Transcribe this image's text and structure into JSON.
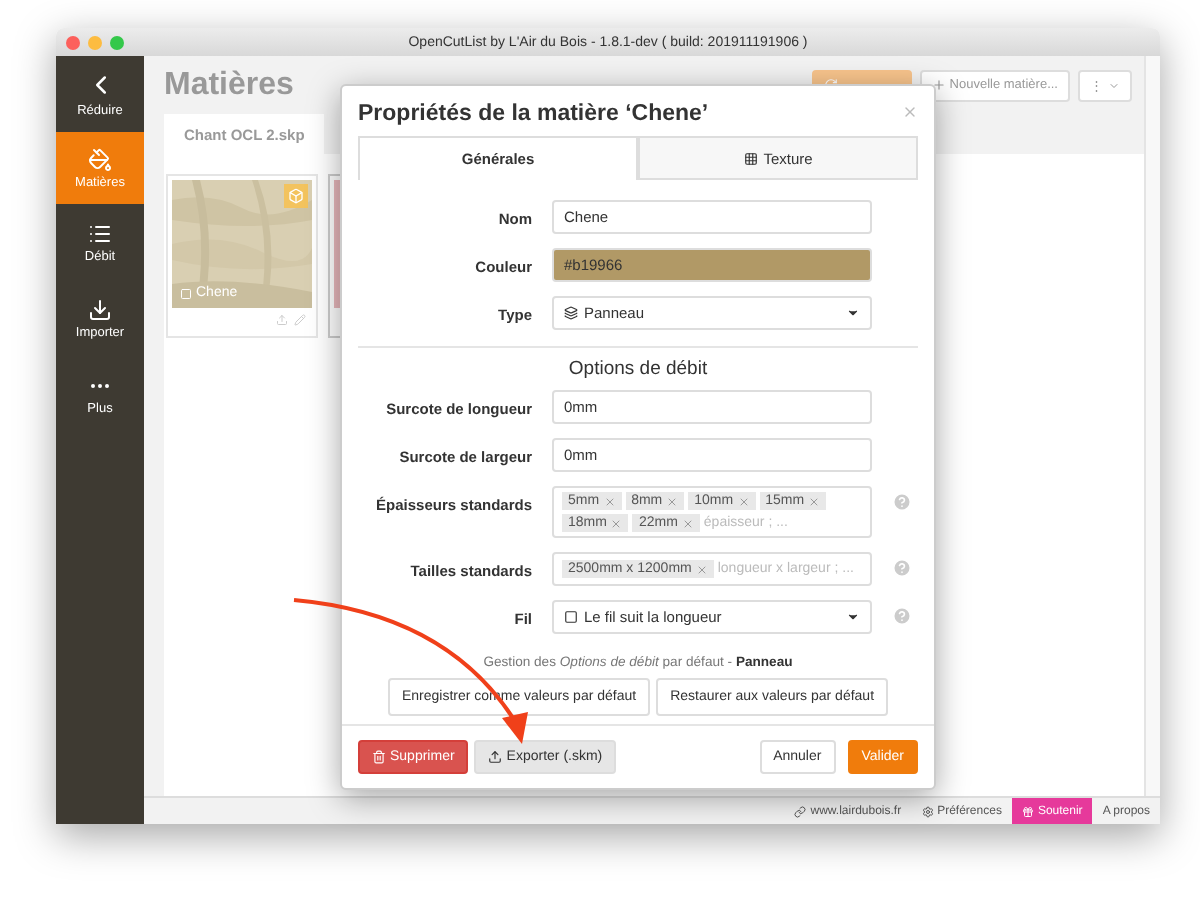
{
  "window": {
    "title": "OpenCutList by L'Air du Bois - 1.8.1-dev ( build: 201911191906 )"
  },
  "sidebar": {
    "items": [
      {
        "label": "Réduire",
        "selected": false
      },
      {
        "label": "Matières",
        "selected": true
      },
      {
        "label": "Débit",
        "selected": false
      },
      {
        "label": "Importer",
        "selected": false
      },
      {
        "label": "Plus",
        "selected": false
      }
    ]
  },
  "page": {
    "title": "Matières",
    "header_buttons": [
      {
        "kind": "primary"
      },
      {
        "kind": "new",
        "label": "Nouvelle matière..."
      },
      {
        "kind": "menu",
        "label": "⋮"
      }
    ]
  },
  "file_tabs": [
    {
      "label": "Chant OCL 2.skp",
      "selected": true
    }
  ],
  "materials": [
    {
      "kind": "wood",
      "name": "Chene"
    },
    {
      "kind": "covered"
    }
  ],
  "dialog": {
    "title": "Propriétés de la matière ‘Chene’",
    "tabs": [
      {
        "label": "Générales",
        "selected": true
      },
      {
        "label": "Texture",
        "selected": false
      }
    ],
    "fields": [
      {
        "kind": "text",
        "label": "Nom",
        "value": "Chene"
      },
      {
        "kind": "color",
        "label": "Couleur",
        "value": "#b19966",
        "color": "#b19966"
      },
      {
        "kind": "select",
        "label": "Type",
        "value": "Panneau"
      }
    ],
    "section": "Options de débit",
    "options": [
      {
        "kind": "text",
        "label": "Surcote de longueur",
        "value": "0mm",
        "help": false
      },
      {
        "kind": "text",
        "label": "Surcote de largeur",
        "value": "0mm",
        "help": false
      },
      {
        "kind": "tags",
        "label": "Épaisseurs standards",
        "tags": [
          "5mm",
          "8mm",
          "10mm",
          "15mm",
          "18mm",
          "22mm"
        ],
        "placeholder": "épaisseur ; ...",
        "help": true
      },
      {
        "kind": "tags",
        "label": "Tailles standards",
        "tags": [
          "2500mm x 1200mm"
        ],
        "placeholder": "longueur x largeur ; ...",
        "help": true
      },
      {
        "kind": "select",
        "label": "Fil",
        "value": "Le fil suit la longueur",
        "help": true
      }
    ],
    "defaults_note": "Gestion des *Options de débit* par défaut - **Panneau**",
    "default_buttons": [
      "Enregistrer comme valeurs par défaut",
      "Restaurer aux valeurs par défaut"
    ],
    "footer_buttons": [
      {
        "kind": "danger",
        "label": "Supprimer"
      },
      {
        "kind": "export",
        "label": "Exporter (.skm)"
      },
      {
        "kind": "cancel",
        "label": "Annuler"
      },
      {
        "kind": "primary",
        "label": "Valider"
      }
    ]
  },
  "status_bar": {
    "items": [
      {
        "kind": "link",
        "label": "www.lairdubois.fr"
      },
      {
        "kind": "prefs",
        "label": "Préférences"
      },
      {
        "kind": "donate",
        "label": "Soutenir"
      },
      {
        "kind": "plain",
        "label": "A propos"
      }
    ]
  }
}
